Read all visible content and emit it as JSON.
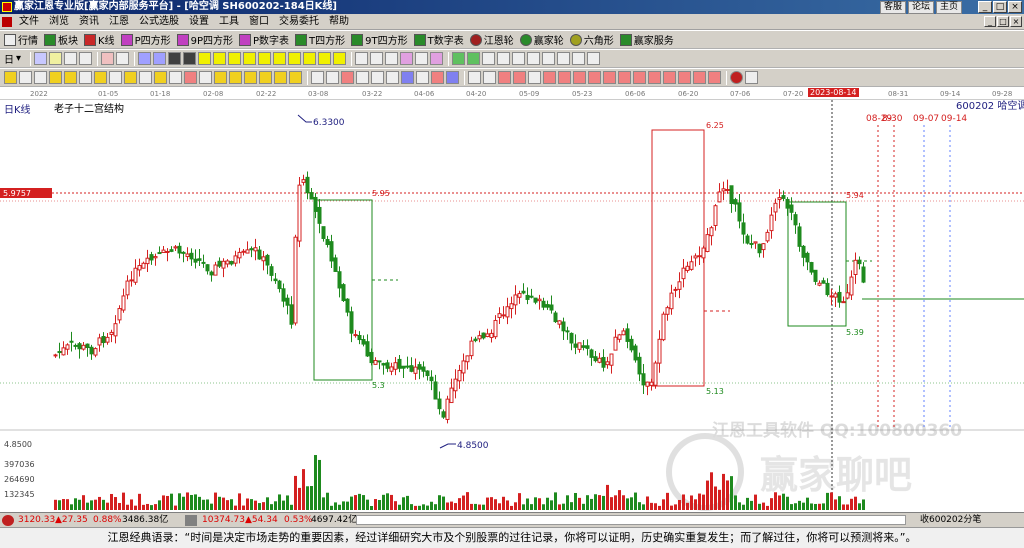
{
  "window": {
    "title": "赢家江恩专业版[赢家内部服务平台] - [哈空调  SH600202-184日K线]",
    "links": [
      "客服",
      "论坛",
      "主页"
    ],
    "controls": [
      "_",
      "□",
      "×"
    ]
  },
  "menu": {
    "items": [
      "文件",
      "浏览",
      "资讯",
      "江恩",
      "公式选股",
      "设置",
      "工具",
      "窗口",
      "交易委托",
      "帮助"
    ],
    "mdi": [
      "_",
      "□",
      "×"
    ]
  },
  "toolbar1": {
    "items": [
      "行情",
      "板块",
      "K线",
      "P四方形",
      "9P四方形",
      "P数字表",
      "T四方形",
      "9T四方形",
      "T数字表",
      "江恩轮",
      "赢家轮",
      "六角形",
      "赢家服务"
    ]
  },
  "toolbar2": {
    "period_label": "日"
  },
  "datebar": {
    "dates": [
      "2022",
      "01-05",
      "01-18",
      "02-08",
      "02-22",
      "03-08",
      "03-22",
      "04-06",
      "04-20",
      "05-09",
      "05-23",
      "06-06",
      "06-20",
      "07-06",
      "07-20",
      "08-03",
      "2023-08-14",
      "08-31",
      "09-14",
      "09-28"
    ]
  },
  "chart": {
    "period_label": "日K线",
    "indicator_label": "老子十二宫结构",
    "stock_label": "600202  哈空调",
    "price_marker": "5.9757",
    "high_label": "6.3300",
    "low_label": "4.8500",
    "left_axis_low": "4.8500",
    "box1_top": "5.95",
    "box1_bottom": "5.3",
    "box2_top": "6.25",
    "box2_bottom": "5.13",
    "box3_top": "5.94",
    "box3_bottom": "5.39",
    "future_dates": [
      "08-29",
      "8-30",
      "09-07",
      "09-14"
    ],
    "watermark_line1": "江恩工具软件  QQ:100800360",
    "watermark_line2": "赢家聊吧",
    "colors": {
      "up": "#d42020",
      "down": "#1e8a1e",
      "box_red": "#d42020",
      "box_green": "#1e8a1e",
      "label_blue": "#202080"
    }
  },
  "volume": {
    "ticks": [
      "397036",
      "264690",
      "132345"
    ]
  },
  "status": {
    "sh_index": "3120.33",
    "sh_change": "▲27.35",
    "sh_pct": "0.88%",
    "sh_amount": "3486.38亿",
    "sz_index": "10374.73",
    "sz_change": "▲54.34",
    "sz_pct": "0.53%",
    "sz_amount": "4697.42亿",
    "right_label": "收600202分笔"
  },
  "quote": {
    "text": "江恩经典语录：“时间是决定市场走势的重要因素，经过详细研究大市及个别股票的过往记录，你将可以证明，历史确实重复发生；而了解过往，你将可以预测将来。”。"
  }
}
